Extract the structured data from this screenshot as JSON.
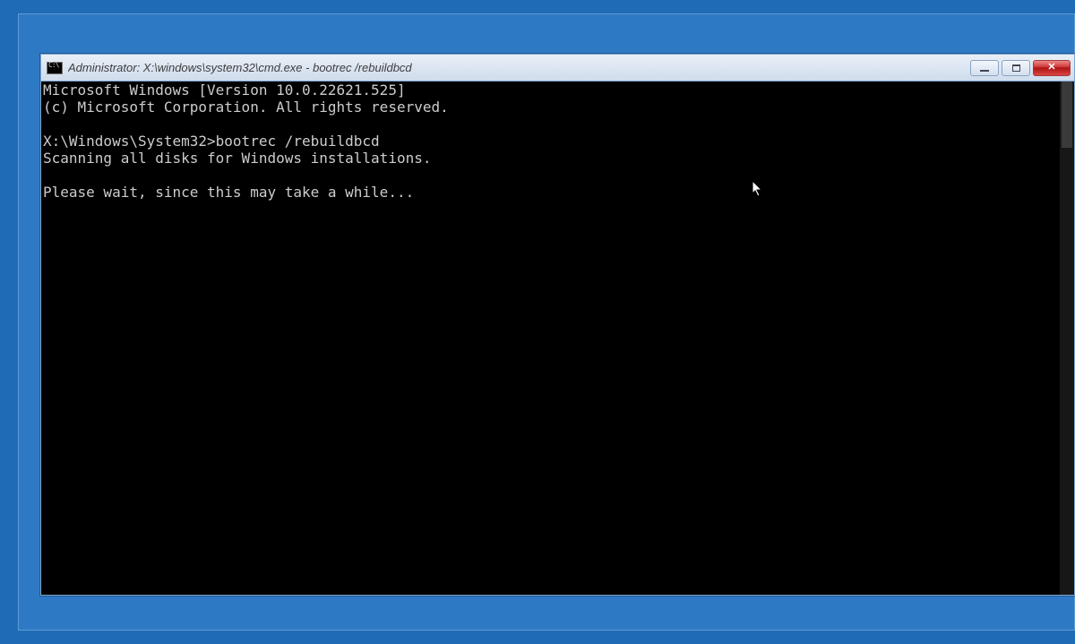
{
  "window": {
    "title": "Administrator: X:\\windows\\system32\\cmd.exe - bootrec /rebuildbcd",
    "sysbuttons": {
      "minimize": "minimize",
      "maximize": "maximize",
      "close": "close"
    }
  },
  "terminal": {
    "lines": [
      "Microsoft Windows [Version 10.0.22621.525]",
      "(c) Microsoft Corporation. All rights reserved.",
      "",
      "X:\\Windows\\System32>bootrec /rebuildbcd",
      "Scanning all disks for Windows installations.",
      "",
      "Please wait, since this may take a while..."
    ]
  },
  "colors": {
    "desktop": "#1f6bb5",
    "terminal_bg": "#000000",
    "terminal_fg": "#cccccc",
    "close_btn": "#c32f2f"
  }
}
